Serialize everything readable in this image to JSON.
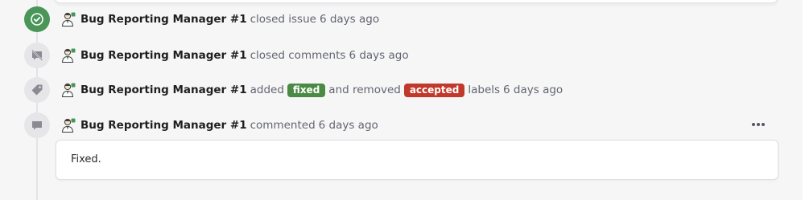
{
  "events": [
    {
      "icon": "check-icon",
      "author": "Bug Reporting Manager #1",
      "action": "closed issue",
      "time": "6 days ago"
    },
    {
      "icon": "comment-slash-icon",
      "author": "Bug Reporting Manager #1",
      "action": "closed comments",
      "time": "6 days ago"
    },
    {
      "icon": "tag-icon",
      "author": "Bug Reporting Manager #1",
      "action_added": "added",
      "label_added": "fixed",
      "label_added_color": "#4a8a45",
      "action_removed": "and removed",
      "label_removed": "accepted",
      "label_removed_color": "#c0392b",
      "suffix": "labels",
      "time": "6 days ago"
    },
    {
      "icon": "comment-icon",
      "author": "Bug Reporting Manager #1",
      "action": "commented",
      "time": "6 days ago",
      "body": "Fixed."
    }
  ],
  "colors": {
    "closed_badge": "#4a9558",
    "muted_badge": "#e6e6e9",
    "icon_gray": "#8a8b92"
  }
}
